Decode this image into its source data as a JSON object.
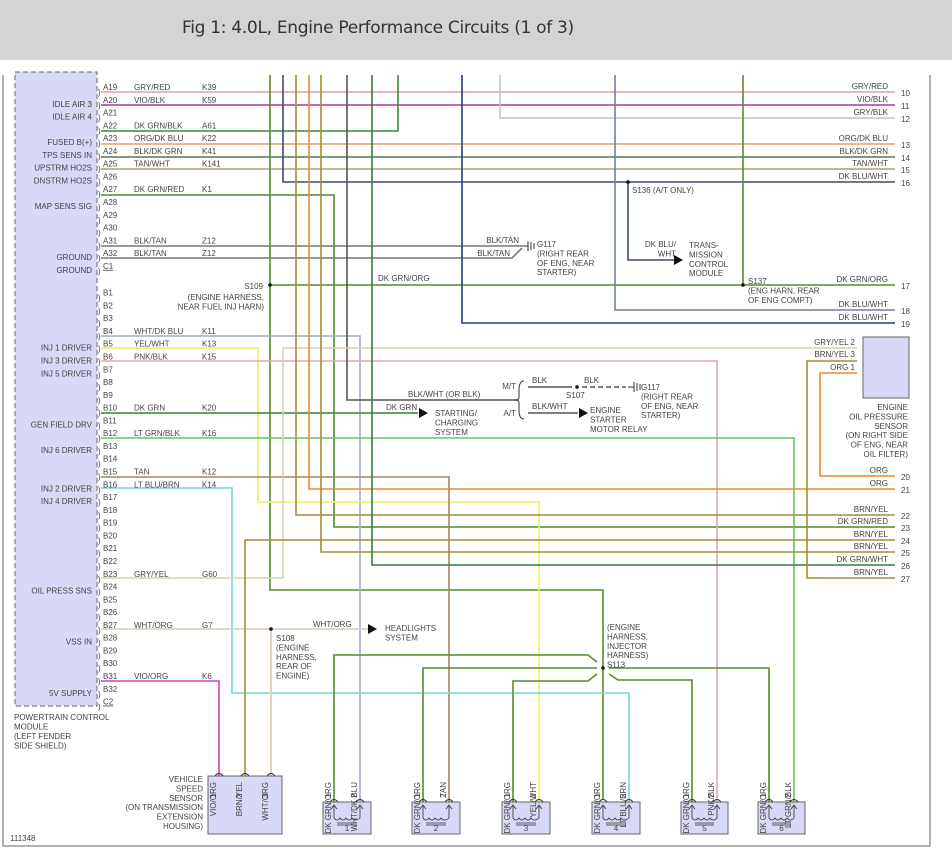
{
  "header": {
    "title": "Fig 1: 4.0L, Engine Performance Circuits (1 of 3)"
  },
  "colors": {
    "GRY/RED": "#e4a0a0",
    "VIO/BLK": "#b030b0",
    "GRY/BLK": "#c4c4c4",
    "DK GRN/BLK": "#3a8a3a",
    "ORG/DK BLU": "#e0a070",
    "BLK/DK GRN": "#4a7a5a",
    "TAN/WHT": "#b0a070",
    "DK BLU/WHT": "#3a4a70",
    "DK GRN/RED": "#4f8a30",
    "BLK/TAN": "#777777",
    "DK GRN/ORG": "#5a8a2a",
    "DK BLU/WHT 18": "#7080a0",
    "DK BLU/WHT 19": "#2a3a80",
    "WHT/DK BLU": "#a4aac8",
    "YEL/WHT": "#eeee60",
    "PNK/BLK": "#e0a8b4",
    "BLK/WHT": "#555555",
    "DK GRN": "#2a8a2a",
    "LT GRN/BLK": "#60c860",
    "TAN": "#a08860",
    "LT BLU/BRN": "#70dada",
    "GRY/YEL": "#d8d0b0",
    "WHT/ORG": "#dccab8",
    "VIO/ORG": "#d040c0",
    "BRN/YEL": "#a09030",
    "ORG": "#e88a30",
    "DK GRN/WHT": "#3a7a3a",
    "BLK": "#555555",
    "module_fill": "#d8d8f8",
    "module_border": "#666666"
  },
  "pcm": {
    "name_lines": [
      "POWERTRAIN CONTROL",
      "MODULE",
      "(LEFT FENDER",
      "SIDE SHIELD)"
    ],
    "pins": [
      {
        "pin": "A19",
        "func": "",
        "wire": "GRY/RED",
        "circuit": "K39"
      },
      {
        "pin": "A20",
        "func": "IDLE AIR 3",
        "wire": "VIO/BLK",
        "circuit": "K59"
      },
      {
        "pin": "A21",
        "func": "IDLE AIR 4",
        "wire": "",
        "circuit": ""
      },
      {
        "pin": "A22",
        "func": "",
        "wire": "DK GRN/BLK",
        "circuit": "A61"
      },
      {
        "pin": "A23",
        "func": "FUSED B(+)",
        "wire": "ORG/DK BLU",
        "circuit": "K22"
      },
      {
        "pin": "A24",
        "func": "TPS SENS IN",
        "wire": "BLK/DK GRN",
        "circuit": "K41"
      },
      {
        "pin": "A25",
        "func": "UPSTRM HO2S",
        "wire": "TAN/WHT",
        "circuit": "K141"
      },
      {
        "pin": "A26",
        "func": "DNSTRM HO2S",
        "wire": "",
        "circuit": ""
      },
      {
        "pin": "A27",
        "func": "",
        "wire": "DK GRN/RED",
        "circuit": "K1"
      },
      {
        "pin": "A28",
        "func": "MAP SENS SIG",
        "wire": "",
        "circuit": ""
      },
      {
        "pin": "A29",
        "func": "",
        "wire": "",
        "circuit": ""
      },
      {
        "pin": "A30",
        "func": "",
        "wire": "",
        "circuit": ""
      },
      {
        "pin": "A31",
        "func": "",
        "wire": "BLK/TAN",
        "circuit": "Z12"
      },
      {
        "pin": "A32",
        "func": "GROUND",
        "wire": "BLK/TAN",
        "circuit": "Z12"
      },
      {
        "pin": "C1",
        "func": "GROUND",
        "wire": "",
        "circuit": ""
      },
      {
        "pin": "B1",
        "func": "",
        "wire": "",
        "circuit": ""
      },
      {
        "pin": "B2",
        "func": "",
        "wire": "",
        "circuit": ""
      },
      {
        "pin": "B3",
        "func": "",
        "wire": "",
        "circuit": ""
      },
      {
        "pin": "B4",
        "func": "",
        "wire": "WHT/DK BLU",
        "circuit": "K11"
      },
      {
        "pin": "B5",
        "func": "INJ 1 DRIVER",
        "wire": "YEL/WHT",
        "circuit": "K13"
      },
      {
        "pin": "B6",
        "func": "INJ 3 DRIVER",
        "wire": "PNK/BLK",
        "circuit": "K15"
      },
      {
        "pin": "B7",
        "func": "INJ 5 DRIVER",
        "wire": "",
        "circuit": ""
      },
      {
        "pin": "B8",
        "func": "",
        "wire": "",
        "circuit": ""
      },
      {
        "pin": "B9",
        "func": "",
        "wire": "",
        "circuit": ""
      },
      {
        "pin": "B10",
        "func": "",
        "wire": "DK GRN",
        "circuit": "K20"
      },
      {
        "pin": "B11",
        "func": "GEN FIELD DRV",
        "wire": "",
        "circuit": ""
      },
      {
        "pin": "B12",
        "func": "",
        "wire": "LT GRN/BLK",
        "circuit": "K16"
      },
      {
        "pin": "B13",
        "func": "INJ 6 DRIVER",
        "wire": "",
        "circuit": ""
      },
      {
        "pin": "B14",
        "func": "",
        "wire": "",
        "circuit": ""
      },
      {
        "pin": "B15",
        "func": "",
        "wire": "TAN",
        "circuit": "K12"
      },
      {
        "pin": "B16",
        "func": "INJ 2 DRIVER",
        "wire": "LT BLU/BRN",
        "circuit": "K14"
      },
      {
        "pin": "B17",
        "func": "INJ 4 DRIVER",
        "wire": "",
        "circuit": ""
      },
      {
        "pin": "B18",
        "func": "",
        "wire": "",
        "circuit": ""
      },
      {
        "pin": "B19",
        "func": "",
        "wire": "",
        "circuit": ""
      },
      {
        "pin": "B20",
        "func": "",
        "wire": "",
        "circuit": ""
      },
      {
        "pin": "B21",
        "func": "",
        "wire": "",
        "circuit": ""
      },
      {
        "pin": "B22",
        "func": "",
        "wire": "",
        "circuit": ""
      },
      {
        "pin": "B23",
        "func": "",
        "wire": "GRY/YEL",
        "circuit": "G60"
      },
      {
        "pin": "B24",
        "func": "OIL PRESS SNS",
        "wire": "",
        "circuit": ""
      },
      {
        "pin": "B25",
        "func": "",
        "wire": "",
        "circuit": ""
      },
      {
        "pin": "B26",
        "func": "",
        "wire": "",
        "circuit": ""
      },
      {
        "pin": "B27",
        "func": "",
        "wire": "WHT/ORG",
        "circuit": "G7"
      },
      {
        "pin": "B28",
        "func": "VSS IN",
        "wire": "",
        "circuit": ""
      },
      {
        "pin": "B29",
        "func": "",
        "wire": "",
        "circuit": ""
      },
      {
        "pin": "B30",
        "func": "",
        "wire": "",
        "circuit": ""
      },
      {
        "pin": "B31",
        "func": "",
        "wire": "VIO/ORG",
        "circuit": "K6"
      },
      {
        "pin": "B32",
        "func": "5V SUPPLY",
        "wire": "",
        "circuit": ""
      },
      {
        "pin": "C2",
        "func": "",
        "wire": "",
        "circuit": ""
      }
    ]
  },
  "terminals": [
    {
      "num": "10",
      "wire": "GRY/RED"
    },
    {
      "num": "11",
      "wire": "VIO/BLK"
    },
    {
      "num": "12",
      "wire": "GRY/BLK"
    },
    {
      "num": "13",
      "wire": "ORG/DK BLU"
    },
    {
      "num": "14",
      "wire": "BLK/DK GRN"
    },
    {
      "num": "15",
      "wire": "TAN/WHT"
    },
    {
      "num": "16",
      "wire": "DK BLU/WHT"
    },
    {
      "num": "17",
      "wire": "DK GRN/ORG"
    },
    {
      "num": "18",
      "wire": "DK BLU/WHT"
    },
    {
      "num": "19",
      "wire": "DK BLU/WHT"
    },
    {
      "num": "20",
      "wire": "ORG"
    },
    {
      "num": "21",
      "wire": "ORG"
    },
    {
      "num": "22",
      "wire": "BRN/YEL"
    },
    {
      "num": "23",
      "wire": "DK GRN/RED"
    },
    {
      "num": "24",
      "wire": "BRN/YEL"
    },
    {
      "num": "25",
      "wire": "BRN/YEL"
    },
    {
      "num": "26",
      "wire": "DK GRN/WHT"
    },
    {
      "num": "27",
      "wire": "BRN/YEL"
    }
  ],
  "notes": [
    {
      "lines": [
        "S109"
      ]
    },
    {
      "lines": [
        "(ENGINE HARNESS,",
        "NEAR FUEL INJ HARN)"
      ]
    },
    {
      "lines": [
        "BLK/TAN"
      ]
    },
    {
      "lines": [
        "BLK/TAN"
      ]
    },
    {
      "lines": [
        "G117",
        "(RIGHT REAR",
        "OF ENG, NEAR",
        "STARTER)"
      ]
    },
    {
      "lines": [
        "DK GRN/ORG"
      ]
    },
    {
      "lines": [
        "S136   (A/T ONLY)"
      ]
    },
    {
      "lines": [
        "DK BLU/",
        "WHT"
      ]
    },
    {
      "lines": [
        "TRANS-",
        "MISSION",
        "CONTROL",
        "MODULE"
      ]
    },
    {
      "lines": [
        "S137",
        "(ENG HARN, REAR",
        "OF ENG COMPT)"
      ]
    },
    {
      "lines": [
        "BLK/WHT (OR BLK)"
      ]
    },
    {
      "lines": [
        "DK GRN"
      ]
    },
    {
      "lines": [
        "STARTING/",
        "CHARGING",
        "SYSTEM"
      ]
    },
    {
      "lines": [
        "M/T"
      ]
    },
    {
      "lines": [
        "A/T"
      ]
    },
    {
      "lines": [
        "BLK"
      ]
    },
    {
      "lines": [
        "BLK"
      ]
    },
    {
      "lines": [
        "S107"
      ]
    },
    {
      "lines": [
        "BLK/WHT"
      ]
    },
    {
      "lines": [
        "ENGINE",
        "STARTER",
        "MOTOR RELAY"
      ]
    },
    {
      "lines": [
        "G117",
        "(RIGHT REAR",
        "OF ENG, NEAR",
        "STARTER)"
      ]
    },
    {
      "lines": [
        "ENGINE",
        "OIL PRESSURE",
        "SENSOR",
        "(ON RIGHT SIDE",
        "OF ENG, NEAR",
        "OIL FILTER)"
      ]
    },
    {
      "lines": [
        "GRY/YEL  2"
      ]
    },
    {
      "lines": [
        "BRN/YEL  3"
      ]
    },
    {
      "lines": [
        "ORG  1"
      ]
    },
    {
      "lines": [
        "S108",
        "(ENGINE",
        "HARNESS,",
        "REAR OF",
        "ENGINE)"
      ]
    },
    {
      "lines": [
        "WHT/ORG"
      ]
    },
    {
      "lines": [
        "HEADLIGHTS",
        "SYSTEM"
      ]
    },
    {
      "lines": [
        "(ENGINE",
        "HARNESS,",
        "INJECTOR",
        "HARNESS)",
        "S113"
      ]
    },
    {
      "lines": [
        "VEHICLE",
        "SPEED",
        "SENSOR",
        "(ON TRANSMISSION",
        "EXTENSION",
        "HOUSING)"
      ]
    },
    {
      "lines": [
        "111348"
      ]
    }
  ],
  "vss_pins": [
    {
      "num": "1",
      "wire": "VIO/ORG"
    },
    {
      "num": "2",
      "wire": "BRN/YEL"
    },
    {
      "num": "3",
      "wire": "WHT/ORG"
    }
  ],
  "injectors": [
    {
      "num": "1",
      "pin1": {
        "num": "1",
        "wire": "DK GRN/ORG"
      },
      "pin2": {
        "num": "2",
        "wire": "WHT/DK BLU"
      }
    },
    {
      "num": "2",
      "pin1": {
        "num": "1",
        "wire": "DK GRN/ORG"
      },
      "pin2": {
        "num": "2",
        "wire": "TAN"
      }
    },
    {
      "num": "3",
      "pin1": {
        "num": "1",
        "wire": "DK GRN/ORG"
      },
      "pin2": {
        "num": "2",
        "wire": "YEL/WHT"
      }
    },
    {
      "num": "4",
      "pin1": {
        "num": "1",
        "wire": "DK GRN/ORG"
      },
      "pin2": {
        "num": "2",
        "wire": "LT BLU/BRN"
      }
    },
    {
      "num": "5",
      "pin1": {
        "num": "1",
        "wire": "DK GRN/ORG"
      },
      "pin2": {
        "num": "2",
        "wire": "PNK/BLK"
      }
    },
    {
      "num": "6",
      "pin1": {
        "num": "1",
        "wire": "DK GRN/ORG"
      },
      "pin2": {
        "num": "2",
        "wire": "LT GRN/BLK"
      }
    }
  ]
}
